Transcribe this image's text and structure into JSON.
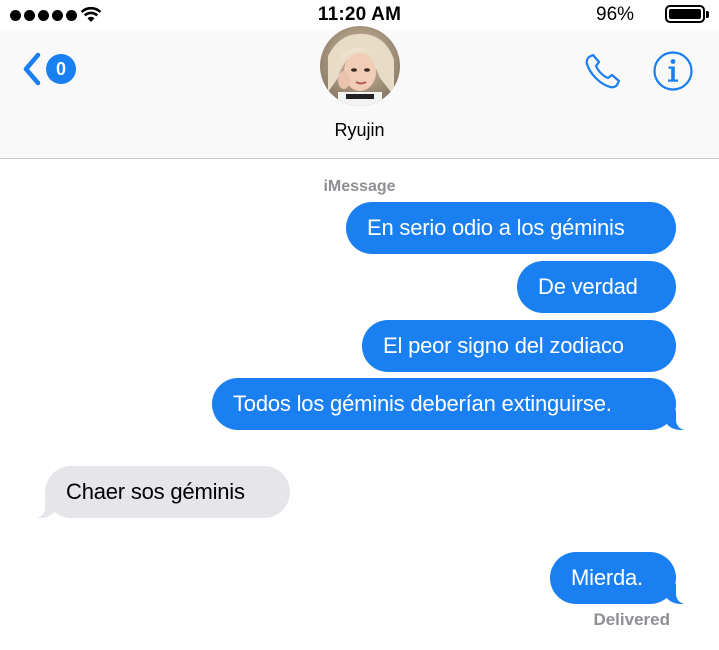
{
  "status_bar": {
    "time": "11:20 AM",
    "battery_percent": "96%",
    "signal_bars": 5,
    "battery_level": 0.96
  },
  "header": {
    "back_badge": "0",
    "contact_name": "Ryujin",
    "icons": [
      "back-chevron-icon",
      "phone-icon",
      "info-icon"
    ]
  },
  "conversation": {
    "service_label": "iMessage",
    "messages": [
      {
        "from": "me",
        "text": "En serio odio a los géminis"
      },
      {
        "from": "me",
        "text": "De verdad"
      },
      {
        "from": "me",
        "text": "El peor signo del zodiaco"
      },
      {
        "from": "me",
        "text": "Todos los géminis deberían extinguirse."
      },
      {
        "from": "them",
        "text": "Chaer sos géminis"
      },
      {
        "from": "me",
        "text": "Mierda."
      }
    ],
    "delivery_status": "Delivered"
  },
  "colors": {
    "accent": "#1a7ff1",
    "outgoing_bubble": "#1a7ff1",
    "incoming_bubble": "#e5e5ea",
    "secondary_text": "#8e8e93"
  }
}
